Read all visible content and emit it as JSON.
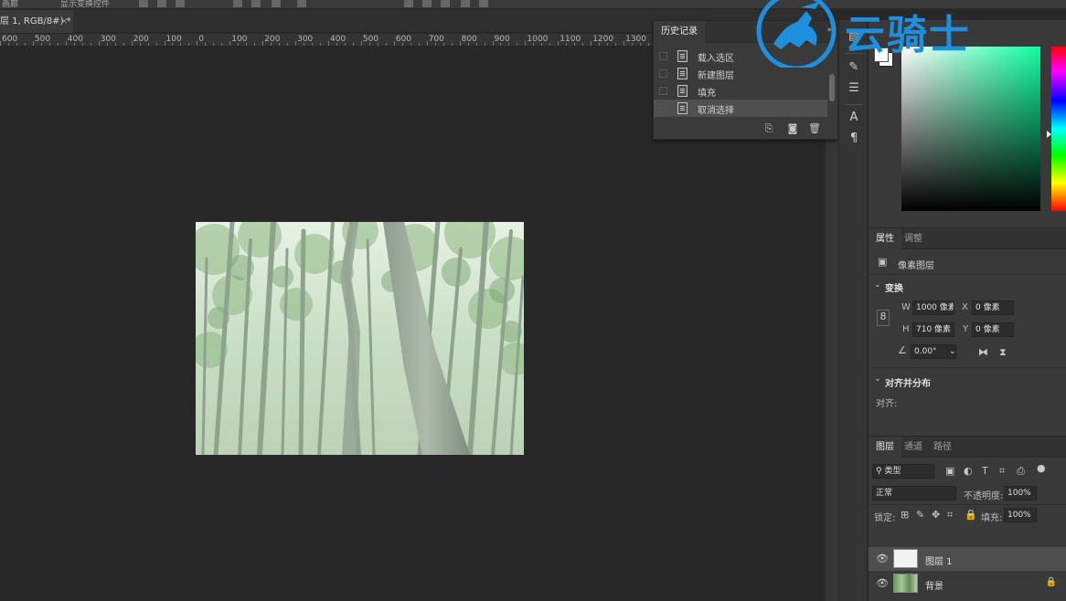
{
  "options_bar": {
    "item1": "画廊",
    "item2": "显示变换控件"
  },
  "document_tab": {
    "title": "层 1, RGB/8#) *",
    "close": "×"
  },
  "ruler": {
    "labels": [
      "600",
      "500",
      "400",
      "300",
      "200",
      "100",
      "0",
      "100",
      "200",
      "300",
      "400",
      "500",
      "600",
      "700",
      "800",
      "900",
      "1000",
      "1100",
      "1200",
      "1300"
    ]
  },
  "history": {
    "tab_label": "历史记录",
    "collapse": "»",
    "items": [
      {
        "label": "载入选区"
      },
      {
        "label": "新建图层"
      },
      {
        "label": "填充"
      },
      {
        "label": "取消选择",
        "active": true
      }
    ]
  },
  "color_panel": {
    "foreground": "#ffffff",
    "background": "#ffffff",
    "accent": "#00ffa0"
  },
  "properties": {
    "tabs": [
      "属性",
      "调整"
    ],
    "layer_type": "像素图层",
    "transform_title": "变换",
    "w_label": "W",
    "w_value": "1000 像素",
    "x_label": "X",
    "x_value": "0 像素",
    "h_label": "H",
    "h_value": "710 像素",
    "y_label": "Y",
    "y_value": "0 像素",
    "angle_value": "0.00°",
    "align_title": "对齐并分布",
    "align_label": "对齐:"
  },
  "layers": {
    "tabs": [
      "图层",
      "通道",
      "路径"
    ],
    "filter_label": "类型",
    "blend_mode": "正常",
    "opacity_label": "不透明度:",
    "opacity_value": "100%",
    "lock_label": "锁定:",
    "fill_label": "填充:",
    "fill_value": "100%",
    "items": [
      {
        "name": "图层 1",
        "active": true
      },
      {
        "name": "背景",
        "locked": true
      }
    ]
  },
  "watermark": {
    "text": "云骑士"
  },
  "colors": {
    "brand_blue": "#1d8fdc",
    "panel": "#393939",
    "canvas": "#282828"
  }
}
